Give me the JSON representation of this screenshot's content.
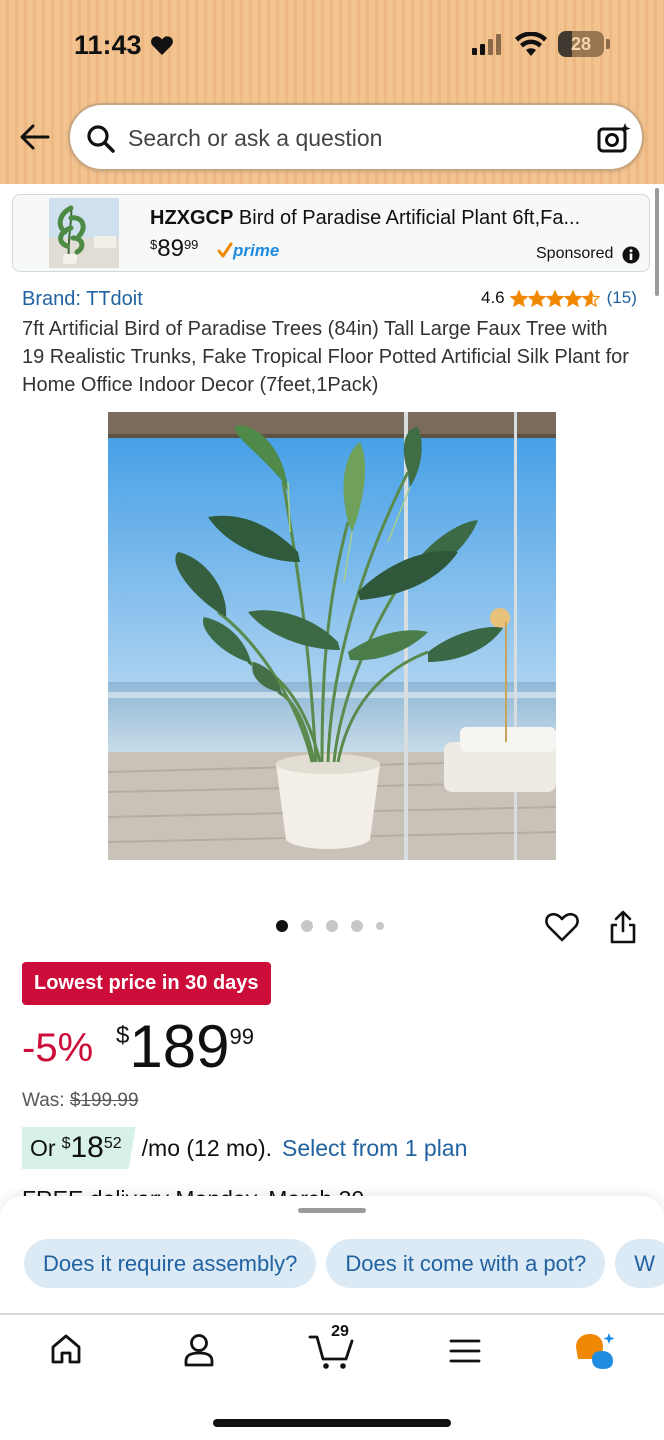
{
  "status_bar": {
    "time": "11:43",
    "battery": "28"
  },
  "search": {
    "placeholder": "Search or ask a question"
  },
  "sponsored_ad": {
    "brand": "HZXGCP",
    "title": "Bird of Paradise Artificial Plant 6ft,Fa...",
    "price_symbol": "$",
    "price_whole": "89",
    "price_fraction": "99",
    "prime_label": "prime",
    "sponsored_label": "Sponsored"
  },
  "product": {
    "brand_link": "Brand: TTdoit",
    "rating_value": "4.6",
    "rating_stars": 4.6,
    "rating_count": "(15)",
    "title": "7ft Artificial Bird of Paradise Trees (84in) Tall Large Faux Tree with 19 Realistic Trunks, Fake Tropical Floor Potted Artificial Silk Plant for Home Office Indoor Decor (7feet,1Pack)",
    "image_count": 5,
    "active_image": 1,
    "deal_badge": "Lowest price in 30 days",
    "discount": "-5%",
    "price_symbol": "$",
    "price_whole": "189",
    "price_fraction": "99",
    "was_label": "Was:",
    "was_price": "$199.99",
    "emi_prefix": "Or",
    "emi_symbol": "$",
    "emi_whole": "18",
    "emi_fraction": "52",
    "emi_suffix": "/mo (12 mo).",
    "emi_link": "Select from 1 plan",
    "delivery_partial": "FREE delivery Monday, March 30"
  },
  "ai_chips": [
    "Does it require assembly?",
    "Does it come with a pot?",
    "W"
  ],
  "tab_bar": {
    "items": [
      "home-icon",
      "account-icon",
      "cart-icon",
      "menu-icon",
      "rufus-icon"
    ],
    "cart_count": "29"
  },
  "colors": {
    "header_bg": "#f2c28f",
    "deal_red": "#cc0c39",
    "link_blue": "#2162a1",
    "star_orange": "#f08804",
    "emi_green": "#d7f1e8",
    "chip_bg": "#dceaf6"
  }
}
